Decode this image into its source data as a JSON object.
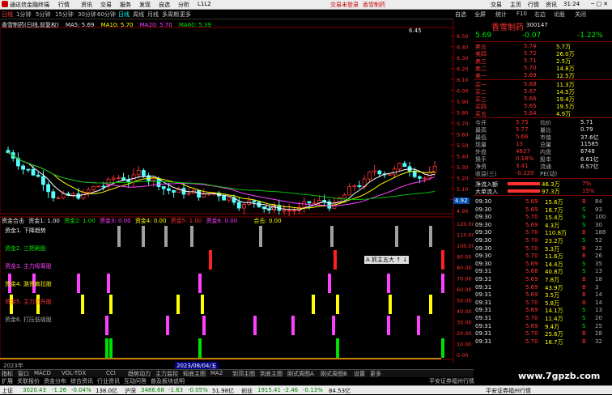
{
  "app": {
    "title": "通达信金融终端",
    "menu": [
      "行情",
      "资讯",
      "交易",
      "服务",
      "发现",
      "自选",
      "分析",
      "L1L2"
    ],
    "alert": "交易未登录",
    "stock_label": "香雪制药",
    "right_menu": [
      "交易",
      "主页",
      "行情",
      "资讯",
      "31:24"
    ]
  },
  "periods": [
    "日线",
    "1分钟",
    "5分钟",
    "15分钟",
    "30分钟",
    "60分钟",
    "日线",
    "周线",
    "月线",
    "多周期",
    "更多"
  ],
  "right_tools": [
    "自选",
    "全屏",
    "统计",
    "F10",
    "右边",
    "论股",
    "关闭"
  ],
  "chart_header": {
    "name": "香雪制药(日线,前复权)",
    "ma5": "MA5: 5.69",
    "ma10": "MA10: 5.70",
    "ma20": "MA20: 5.70",
    "ma60": "MA60: 5.39"
  },
  "price_scale": [
    "6.50",
    "6.40",
    "6.30",
    "6.20",
    "6.10",
    "6.00",
    "5.90",
    "5.80",
    "5.70",
    "5.60",
    "5.50",
    "5.40",
    "5.30",
    "5.20",
    "5.10",
    "5.00",
    "4.90"
  ],
  "ind_scale": [
    "120.00",
    "110.00",
    "100.00",
    "90.00",
    "80.00",
    "70.00",
    "60.00",
    "50.00",
    "40.00",
    "30.00",
    "20.00",
    "10.00",
    "0.00"
  ],
  "high_label": "6.45",
  "low_label": "4.89",
  "cur_price_tag": "4.92",
  "indicator": {
    "header": [
      "资金合击",
      "资金1: 1.00",
      "资金2: 1.00",
      "资金3: 0.00",
      "资金4: 0.00",
      "资金5: 1.00",
      "资金6: 0.00",
      "合击: 0.00"
    ],
    "labels": [
      "资金1. 下降趋势",
      "资金2. 三把刷股",
      "资金3. 主力吸筹股",
      "资金4. 游资疯拉股",
      "资金5. 主力拉升股",
      "资金6. 打压低吸股"
    ],
    "badge": "A 抓主五大 ↑ ↓"
  },
  "date_mid": "2023/08/04/五",
  "date_left": "2023年",
  "bottom_tabs": [
    "指标",
    "窗口",
    "MACD",
    "VOL-TDX",
    "CCI",
    "趋势动力",
    "主力监控",
    "知底主图",
    "MA2",
    "到顶主图",
    "到底主图",
    "刚式周图A",
    "刚式周图B",
    "设置",
    "更多"
  ],
  "bottom_tabs2": [
    "扩展",
    "关联报价",
    "资金分布",
    "综合资讯",
    "行业资讯",
    "互动问答",
    "普及板块说明",
    "平安证券福州行情"
  ],
  "quote": {
    "name": "香雪制药",
    "code": "300147",
    "price": "5.69",
    "change": "-0.07",
    "pct": "-1.22%",
    "asks": [
      {
        "l": "卖五",
        "p": "5.74",
        "v": "5.7万"
      },
      {
        "l": "卖四",
        "p": "5.72",
        "v": "26.0万"
      },
      {
        "l": "卖三",
        "p": "5.71",
        "v": "2.5万"
      },
      {
        "l": "卖二",
        "p": "5.70",
        "v": "14.8万"
      },
      {
        "l": "卖一",
        "p": "5.69",
        "v": "12.5万"
      }
    ],
    "bids": [
      {
        "l": "买一",
        "p": "5.68",
        "v": "11.3万"
      },
      {
        "l": "买二",
        "p": "5.67",
        "v": "14.5万"
      },
      {
        "l": "买三",
        "p": "5.66",
        "v": "19.4万"
      },
      {
        "l": "买四",
        "p": "5.65",
        "v": "19.5万"
      },
      {
        "l": "买五",
        "p": "5.64",
        "v": "4.9万"
      }
    ],
    "stats": [
      [
        "今开",
        "5.75",
        "均价",
        "5.71"
      ],
      [
        "最高",
        "5.77",
        "量比",
        "0.79"
      ],
      [
        "最低",
        "5.66",
        "市值",
        "37.6亿"
      ],
      [
        "现量",
        "13",
        "总量",
        "11585"
      ],
      [
        "外盘",
        "4637",
        "内盘",
        "6748"
      ],
      [
        "换手",
        "0.18%",
        "股本",
        "6.61亿"
      ],
      [
        "净资",
        "3.41",
        "流通",
        "6.57亿"
      ],
      [
        "收益(三)",
        "-0.220",
        "PE(动)",
        ""
      ]
    ],
    "flows": [
      {
        "l": "净流入额",
        "v": "46.3万",
        "p": "7%"
      },
      {
        "l": "大单流入",
        "v": "97.3万",
        "p": "15%"
      }
    ],
    "ticks": [
      [
        "09:30",
        "5.69",
        "15.6万",
        "B",
        "84"
      ],
      [
        "09:30",
        "5.69",
        "18.7万",
        "S",
        "93"
      ],
      [
        "09:30",
        "5.70",
        "15.4万",
        "S",
        "100"
      ],
      [
        "09:30",
        "5.69",
        "4.3万",
        "S",
        "30"
      ],
      [
        "09:30",
        "5.70",
        "110.8万",
        "B",
        "188"
      ],
      [
        "09:30",
        "5.70",
        "23.2万",
        "S",
        "52"
      ],
      [
        "09:30",
        "5.70",
        "5.3万",
        "B",
        "22"
      ],
      [
        "09:30",
        "5.70",
        "11.6万",
        "B",
        "26"
      ],
      [
        "09:30",
        "5.69",
        "14.4万",
        "S",
        "35"
      ],
      [
        "09:31",
        "5.68",
        "40.8万",
        "S",
        "13"
      ],
      [
        "09:31",
        "5.69",
        "7.8万",
        "B",
        "18"
      ],
      [
        "09:31",
        "5.69",
        "43.9万",
        "B",
        "3"
      ],
      [
        "09:31",
        "5.69",
        "3.5万",
        "B",
        "14"
      ],
      [
        "09:31",
        "5.70",
        "5.8万",
        "B",
        "14"
      ],
      [
        "09:31",
        "5.69",
        "14.1万",
        "S",
        "13"
      ],
      [
        "09:31",
        "5.70",
        "11.4万",
        "S",
        "20"
      ],
      [
        "09:31",
        "5.69",
        "9.4万",
        "S",
        "25"
      ],
      [
        "09:31",
        "5.70",
        "25.6万",
        "B",
        "28"
      ],
      [
        "09:31",
        "5.70",
        "16.7万",
        "B",
        "32"
      ]
    ]
  },
  "status": {
    "sh_label": "上证",
    "sh": "3020.43",
    "sh_chg": "-1.26",
    "sh_pct": "-0.04%",
    "sh_amt": "138.0亿",
    "sz_label": "沪深",
    "sz": "3486.68",
    "sz_chg": "-1.63",
    "sz_pct": "-0.05%",
    "sz_amt": "51.98亿",
    "cy_label": "创业",
    "cy": "1915.41",
    "cy_chg": "-2.46",
    "cy_pct": "-0.13%",
    "cy_amt": "84.53亿",
    "broker": "平安证券福州行情"
  },
  "watermark": "www.7gpzb.com"
}
